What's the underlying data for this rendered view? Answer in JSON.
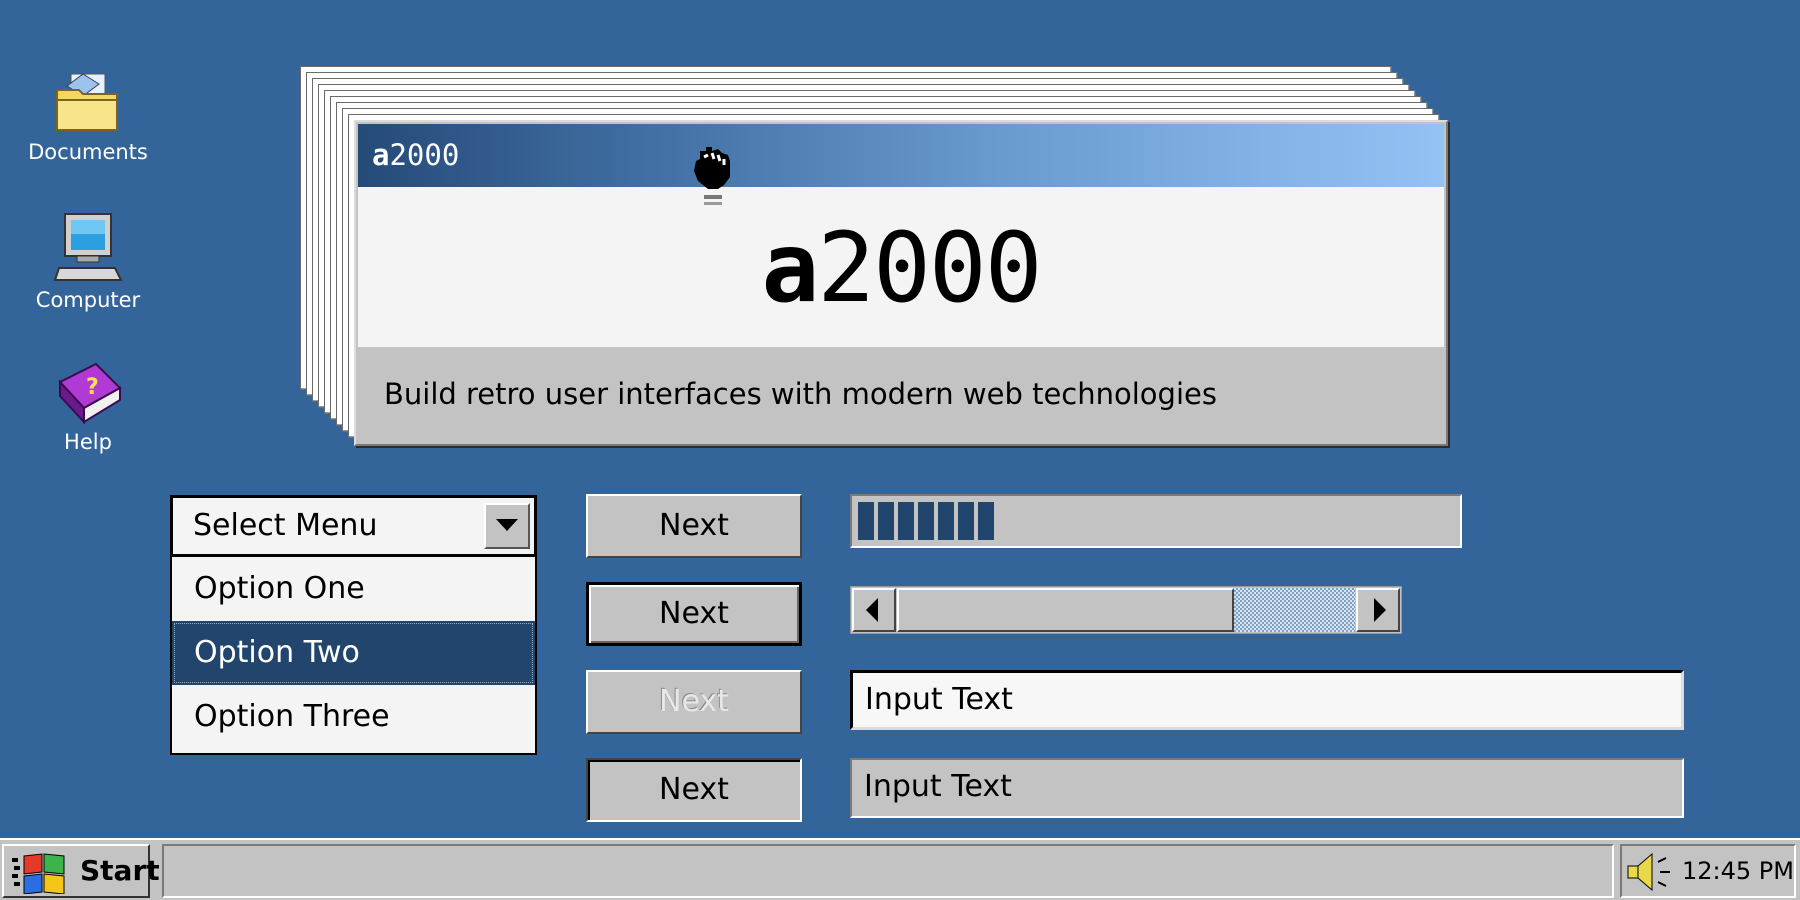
{
  "desktop": {
    "icons": [
      {
        "label": "Documents",
        "icon": "folder-icon"
      },
      {
        "label": "Computer",
        "icon": "computer-icon"
      },
      {
        "label": "Help",
        "icon": "help-book-icon"
      }
    ]
  },
  "window": {
    "title_bold": "a",
    "title_rest": "2000",
    "hero_bold": "a",
    "hero_rest": "2000",
    "tagline": "Build retro user interfaces with modern web technologies"
  },
  "select_menu": {
    "label": "Select Menu",
    "options": [
      "Option One",
      "Option Two",
      "Option Three"
    ],
    "selected_index": 1
  },
  "buttons": [
    {
      "label": "Next",
      "state": "normal"
    },
    {
      "label": "Next",
      "state": "focused"
    },
    {
      "label": "Next",
      "state": "disabled"
    },
    {
      "label": "Next",
      "state": "pressed"
    }
  ],
  "progress": {
    "value": 0.23,
    "segments": 7
  },
  "scrollbar": {
    "position": 0.88
  },
  "inputs": [
    {
      "value": "Input Text",
      "state": "active"
    },
    {
      "value": "Input Text",
      "state": "readonly"
    }
  ],
  "taskbar": {
    "start_label": "Start",
    "clock": "12:45 PM"
  },
  "colors": {
    "desktop": "#33659b",
    "accent": "#22456d",
    "face": "#c3c3c3"
  }
}
